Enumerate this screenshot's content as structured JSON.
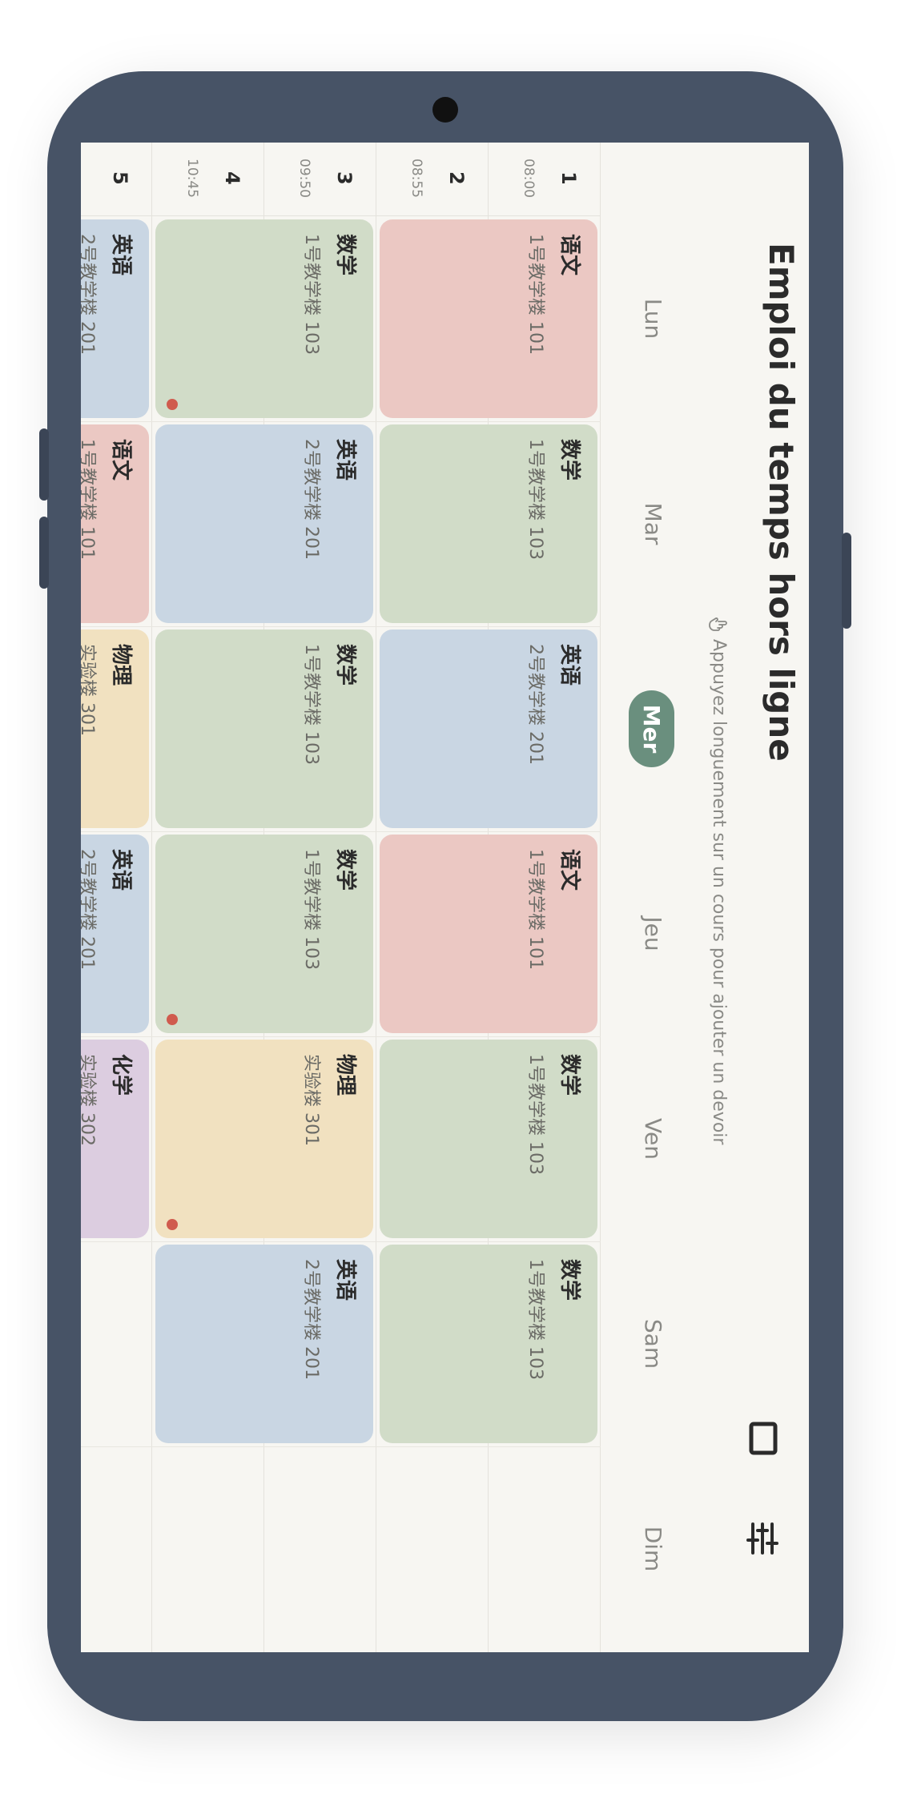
{
  "header": {
    "title": "Emploi du temps hors ligne",
    "hint": "Appuyez longuement sur un cours pour ajouter un devoir",
    "view_icon": "square-view-icon",
    "filter_icon": "sliders-icon"
  },
  "days": [
    "Lun",
    "Mar",
    "Mer",
    "Jeu",
    "Ven",
    "Sam",
    "Dim"
  ],
  "today": "Mer",
  "periods": [
    {
      "num": "1",
      "time": "08:00"
    },
    {
      "num": "2",
      "time": "08:55"
    },
    {
      "num": "3",
      "time": "09:50"
    },
    {
      "num": "4",
      "time": "10:45"
    },
    {
      "num": "5",
      "time": ""
    }
  ],
  "courses": {
    "mon_1": {
      "name": "语文",
      "room": "1号教学楼 101"
    },
    "mon_3": {
      "name": "数学",
      "room": "1号教学楼 103"
    },
    "mon_5": {
      "name": "英语",
      "room": "2号教学楼 201"
    },
    "tue_1": {
      "name": "数学",
      "room": "1号教学楼 103"
    },
    "tue_3": {
      "name": "英语",
      "room": "2号教学楼 201"
    },
    "tue_5": {
      "name": "语文",
      "room": "1号教学楼 101"
    },
    "wed_1": {
      "name": "英语",
      "room": "2号教学楼 201"
    },
    "wed_3": {
      "name": "数学",
      "room": "1号教学楼 103"
    },
    "wed_5": {
      "name": "物理",
      "room": "实验楼 301"
    },
    "thu_1": {
      "name": "语文",
      "room": "1号教学楼 101"
    },
    "thu_3": {
      "name": "数学",
      "room": "1号教学楼 103"
    },
    "thu_5": {
      "name": "英语",
      "room": "2号教学楼 201"
    },
    "fri_1": {
      "name": "数学",
      "room": "1号教学楼 103"
    },
    "fri_3": {
      "name": "物理",
      "room": "实验楼 301"
    },
    "fri_5": {
      "name": "化学",
      "room": "实验楼 302"
    },
    "sat_1": {
      "name": "数学",
      "room": "1号教学楼 103"
    },
    "sat_3": {
      "name": "英语",
      "room": "2号教学楼 201"
    }
  },
  "colors": {
    "accent": "#6a8f7e",
    "homework_dot": "#d05b4e",
    "chinese": "#ebc8c3",
    "math": "#d1dcc8",
    "english": "#c9d6e3",
    "physics": "#f1e1c0",
    "chemistry": "#dccde0"
  }
}
